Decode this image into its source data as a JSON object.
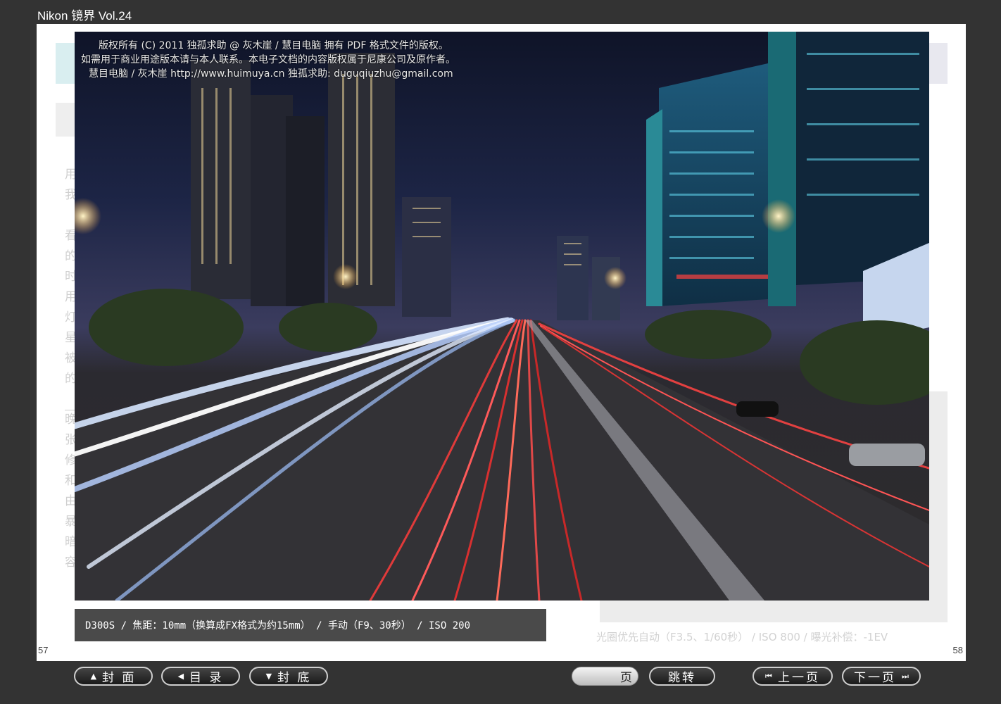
{
  "window": {
    "title": "Nikon 镜界 Vol.24"
  },
  "copyright": {
    "line1": "版权所有 (C) 2011 独孤求助 @ 灰木崖 / 慧目电脑 拥有 PDF 格式文件的版权。",
    "line2": "如需用于商业用途版本请与本人联系。本电子文档的内容版权属于尼康公司及原作者。",
    "line3": "慧目电脑 / 灰木崖 http://www.huimuya.cn  独孤求助: duguqiuzhu@gmail.com"
  },
  "photo_caption": "D300S / 焦距：10mm（换算成FX格式为约15mm） / 手动（F9、30秒） / ISO 200",
  "background_page": {
    "left_column_chars": [
      "用",
      "我",
      "",
      "看",
      "的",
      "时",
      "用",
      "灯",
      "星",
      "被",
      "的",
      "",
      "晚",
      "张",
      "修",
      "和",
      "由",
      "暴",
      "暗",
      "容"
    ],
    "right_caption": "光圈优先自动（F3.5、1/60秒） / ISO 800 / 曝光补偿：-1EV",
    "left_page_number": "57",
    "right_page_number": "58"
  },
  "nav": {
    "cover": "封 面",
    "contents": "目 录",
    "back_cover": "封 底",
    "page_label": "页",
    "page_value": "",
    "jump": "跳转",
    "prev": "上一页",
    "next": "下一页"
  },
  "icons": {
    "cover": "triangle-up-icon",
    "contents": "triangle-left-icon",
    "back_cover": "triangle-down-icon",
    "prev": "skip-back-icon",
    "next": "skip-forward-icon"
  }
}
